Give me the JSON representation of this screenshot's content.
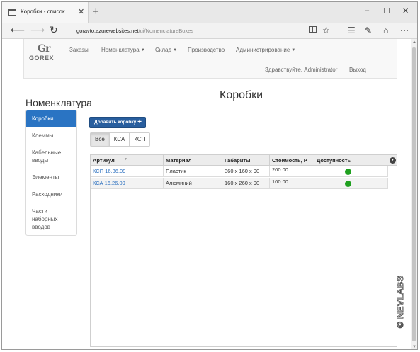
{
  "browser": {
    "tab_title": "Коробки - список",
    "tab_close": "✕",
    "new_tab": "+",
    "win_minimize": "–",
    "win_maximize": "☐",
    "win_close": "✕",
    "url_host": "goravto.azurewebsites.net",
    "url_path": "/ui/NomenclatureBoxes",
    "icons": [
      "back-arrow-icon",
      "forward-arrow-icon",
      "refresh-icon",
      "reading-view-icon",
      "favorite-star-icon",
      "hub-icon",
      "note-icon",
      "share-icon",
      "more-icon"
    ]
  },
  "navbar": {
    "logo_mark": "Gr",
    "logo_text": "GOREX",
    "menu": [
      {
        "label": "Заказы"
      },
      {
        "label": "Номенклатура"
      },
      {
        "label": "Склад"
      },
      {
        "label": "Производство"
      },
      {
        "label": "Администрирование"
      }
    ],
    "greeting": "Здравствуйте, Administrator",
    "logout": "Выход"
  },
  "sidebar": {
    "title": "Номенклатура",
    "items": [
      {
        "label": "Коробки",
        "active": true
      },
      {
        "label": "Клеммы",
        "active": false
      },
      {
        "label": "Кабельные вводы",
        "active": false
      },
      {
        "label": "Элементы",
        "active": false
      },
      {
        "label": "Расходники",
        "active": false
      },
      {
        "label": "Части наборных вводов",
        "active": false
      }
    ]
  },
  "main": {
    "title": "Коробки",
    "add_button": "Добавить коробку",
    "filters": [
      {
        "label": "Все",
        "active": true
      },
      {
        "label": "КСА",
        "active": false
      },
      {
        "label": "КСП",
        "active": false
      }
    ],
    "table": {
      "columns": [
        "Артикул",
        "Материал",
        "Габариты",
        "Стоимость, Р",
        "Доступность"
      ],
      "rows": [
        {
          "article": "КСП 16.36.09",
          "material": "Пластик",
          "size": "360 x 160 x 90",
          "cost": "200.00",
          "available": true
        },
        {
          "article": "КСА 16.26.09",
          "material": "Алюминий",
          "size": "160 x 260 x 90",
          "cost": "100.00",
          "available": true
        }
      ]
    }
  },
  "watermark": "© NEVLABS",
  "colors": {
    "accent": "#2a74c3",
    "button": "#285e9e",
    "available": "#1fa01f",
    "link": "#2a6fbf"
  }
}
